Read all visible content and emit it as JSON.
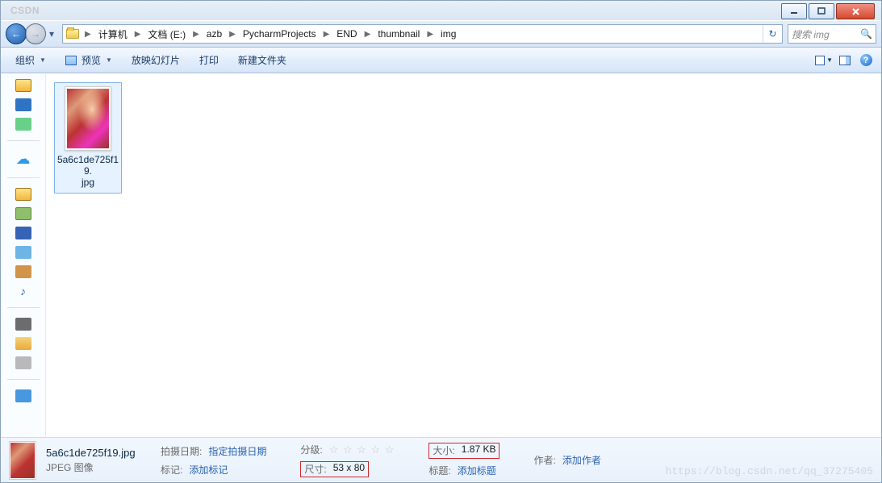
{
  "titlebar": {
    "brand": "CSDN",
    "ghost2": ""
  },
  "window_controls": {
    "min": "min",
    "max": "max",
    "close": "close"
  },
  "breadcrumbs": [
    "计算机",
    "文档 (E:)",
    "azb",
    "PycharmProjects",
    "END",
    "thumbnail",
    "img"
  ],
  "search": {
    "placeholder": "搜索 img"
  },
  "toolbar": {
    "organize": "组织",
    "preview": "预览",
    "slideshow": "放映幻灯片",
    "print": "打印",
    "new_folder": "新建文件夹"
  },
  "file": {
    "name_line1": "5a6c1de725f19.",
    "name_line2": "jpg"
  },
  "details": {
    "filename": "5a6c1de725f19.jpg",
    "filetype": "JPEG 图像",
    "shot_date_label": "拍摄日期:",
    "shot_date_value": "指定拍摄日期",
    "tags_label": "标记:",
    "tags_value": "添加标记",
    "rating_label": "分级:",
    "dimensions_label": "尺寸:",
    "dimensions_value": "53 x 80",
    "size_label": "大小:",
    "size_value": "1.87 KB",
    "title_label": "标题:",
    "title_value": "添加标题",
    "author_label": "作者:",
    "author_value": "添加作者"
  },
  "watermark": "https://blog.csdn.net/qq_37275405"
}
